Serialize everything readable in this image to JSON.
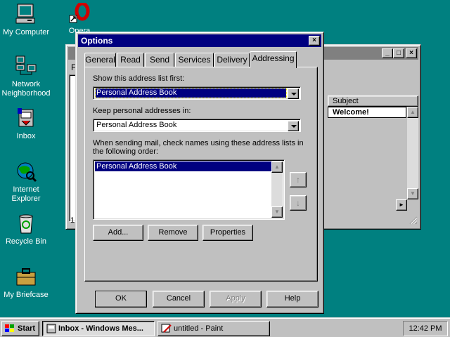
{
  "desktop": {
    "icons": [
      {
        "label": "My Computer"
      },
      {
        "label": "Opera"
      },
      {
        "label": "Network Neighborhood"
      },
      {
        "label": "Inbox"
      },
      {
        "label": "Internet Explorer"
      },
      {
        "label": "Recycle Bin"
      },
      {
        "label": "My Briefcase"
      }
    ]
  },
  "inbox_window": {
    "menu_fragment": "F",
    "column_header": "Subject",
    "first_row_subject": "Welcome!",
    "status_fragment": "1"
  },
  "dialog": {
    "title": "Options",
    "tabs": [
      "General",
      "Read",
      "Send",
      "Services",
      "Delivery",
      "Addressing"
    ],
    "active_tab": "Addressing",
    "show_list_label": "Show this address list first:",
    "show_list_value": "Personal Address Book",
    "keep_label": "Keep personal addresses in:",
    "keep_value": "Personal Address Book",
    "order_label_line1": "When sending mail, check names using these address lists in",
    "order_label_line2": "the following order:",
    "order_items": [
      "Personal Address Book"
    ],
    "add_label": "Add...",
    "remove_label": "Remove",
    "properties_label": "Properties",
    "ok_label": "OK",
    "cancel_label": "Cancel",
    "apply_label": "Apply",
    "help_label": "Help"
  },
  "taskbar": {
    "start_label": "Start",
    "tasks": [
      {
        "label": "Inbox - Windows Mes...",
        "active": true
      },
      {
        "label": "untitled - Paint",
        "active": false
      }
    ],
    "clock": "12:42 PM"
  },
  "colors": {
    "desktop": "#008080",
    "title_active": "#000080",
    "title_inactive": "#808080",
    "face": "#c0c0c0"
  }
}
